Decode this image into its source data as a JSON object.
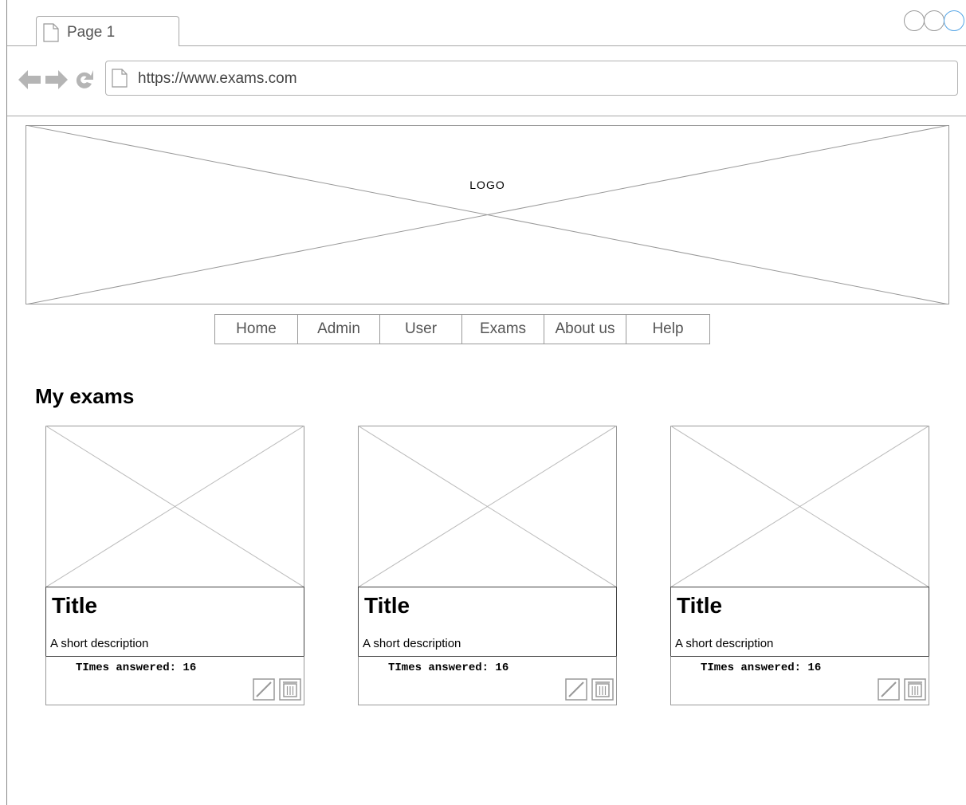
{
  "browser": {
    "tab_label": "Page 1",
    "url": "https://www.exams.com"
  },
  "header": {
    "logo_text": "LOGO"
  },
  "nav": {
    "items": [
      {
        "label": "Home"
      },
      {
        "label": "Admin"
      },
      {
        "label": "User"
      },
      {
        "label": "Exams"
      },
      {
        "label": "About us"
      },
      {
        "label": "Help"
      }
    ]
  },
  "main": {
    "section_title": "My exams",
    "cards": [
      {
        "title": "Title",
        "description": "A short description",
        "times_answered": "TImes answered: 16"
      },
      {
        "title": "Title",
        "description": "A short description",
        "times_answered": "TImes answered: 16"
      },
      {
        "title": "Title",
        "description": "A short description",
        "times_answered": "TImes answered: 16"
      }
    ]
  },
  "icons": {
    "tab": "page-icon",
    "back": "back-arrow-icon",
    "forward": "forward-arrow-icon",
    "reload": "reload-icon",
    "edit": "edit-icon",
    "delete": "trash-icon"
  },
  "colors": {
    "window_active": "#55a5e6",
    "border": "#999999"
  }
}
